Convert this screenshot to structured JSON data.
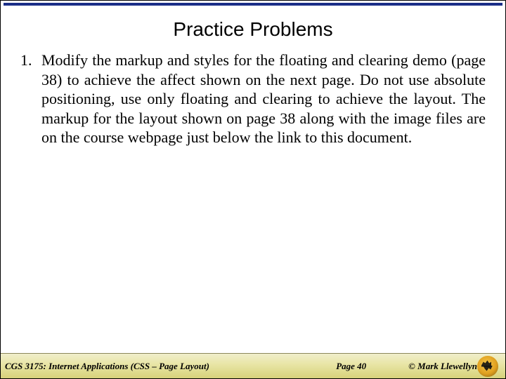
{
  "title": "Practice Problems",
  "items": [
    {
      "number": "1.",
      "text": "Modify the markup and styles for the floating and clearing demo (page 38) to achieve the affect shown on the next page. Do not use absolute positioning, use only floating and clearing to achieve the layout. The markup for the layout shown on page 38 along with the image files are on the course webpage just below the link to this document."
    }
  ],
  "footer": {
    "course": "CGS 3175: Internet Applications (CSS – Page Layout)",
    "page": "Page 40",
    "copyright": "© Mark Llewellyn"
  }
}
